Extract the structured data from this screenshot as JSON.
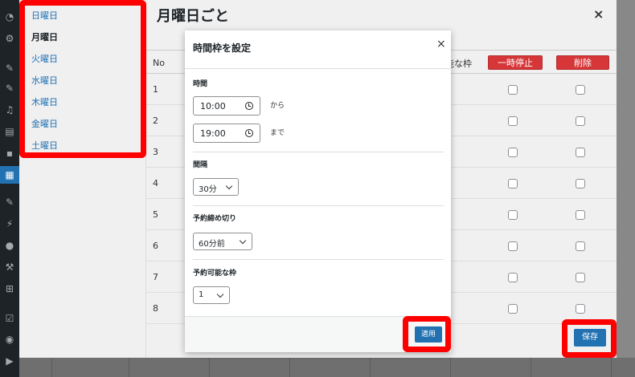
{
  "outer_modal": {
    "title": "月曜日ごと",
    "close_glyph": "×",
    "days": [
      "日曜日",
      "月曜日",
      "火曜日",
      "水曜日",
      "木曜日",
      "金曜日",
      "土曜日"
    ],
    "current_day": "月曜日",
    "grid": {
      "header_no": "No",
      "header_available_partial": "能な枠",
      "pause_button": "一時停止",
      "delete_button": "削除",
      "rows": [
        "1",
        "2",
        "3",
        "4",
        "5",
        "6",
        "7",
        "8"
      ]
    },
    "save_label": "保存"
  },
  "dialog": {
    "title": "時間枠を設定",
    "close_glyph": "×",
    "time_label": "時間",
    "start_time": "10:00",
    "start_suffix": "から",
    "end_time": "19:00",
    "end_suffix": "まで",
    "interval_label": "間隔",
    "interval_value": "30分",
    "deadline_label": "予約締め切り",
    "deadline_value": "60分前",
    "slots_label": "予約可能な枠",
    "slots_value": "1",
    "apply_label": "適用"
  },
  "highlight_color": "#ff0000",
  "accent_color": "#2271b1",
  "danger_color": "#d63638"
}
